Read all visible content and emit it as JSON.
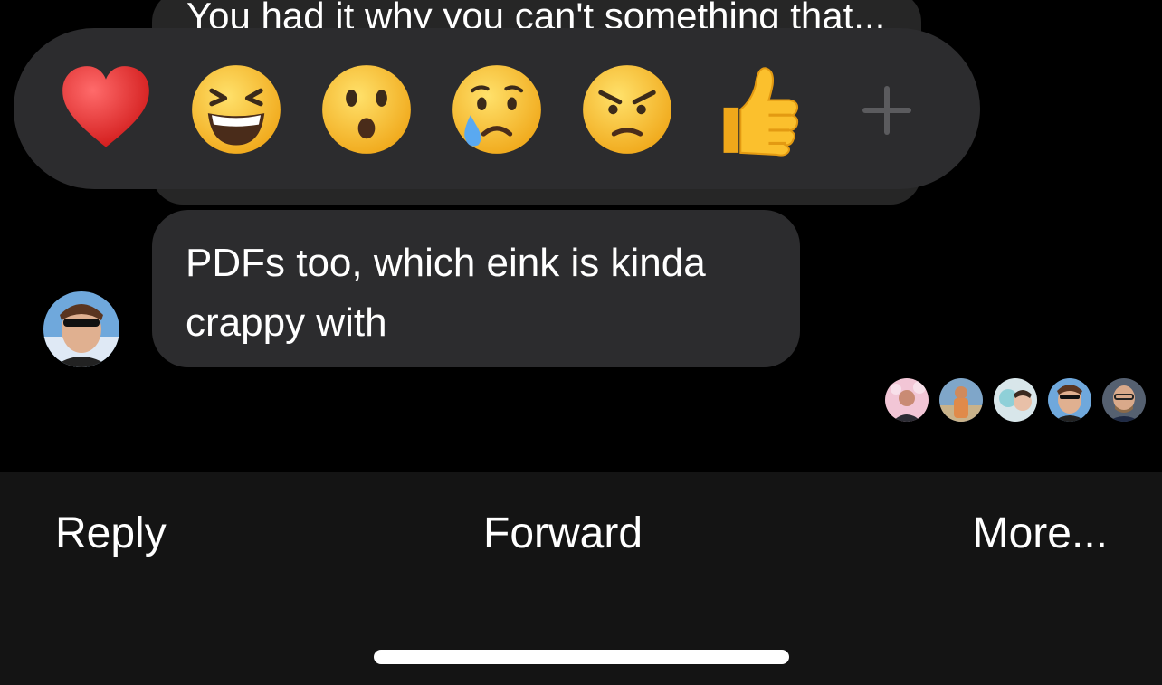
{
  "messages": [
    {
      "text": "You had it why you can't something that..."
    },
    {
      "text": "PDFs too, which eink is kinda crappy with"
    }
  ],
  "reactions": [
    {
      "name": "heart",
      "icon": "heart-icon"
    },
    {
      "name": "laugh",
      "icon": "laughing-face-icon"
    },
    {
      "name": "surprised",
      "icon": "surprised-face-icon"
    },
    {
      "name": "sad",
      "icon": "crying-face-icon"
    },
    {
      "name": "angry",
      "icon": "angry-face-icon"
    },
    {
      "name": "thumbs_up",
      "icon": "thumbs-up-icon"
    },
    {
      "name": "more",
      "icon": "plus-icon"
    }
  ],
  "actions": {
    "reply": "Reply",
    "forward": "Forward",
    "more": "More..."
  },
  "colors": {
    "background": "#000000",
    "bubble": "#2c2c2e",
    "sheet": "#141414",
    "emoji_yellow": "#fbc02d",
    "heart_red": "#e53935"
  }
}
